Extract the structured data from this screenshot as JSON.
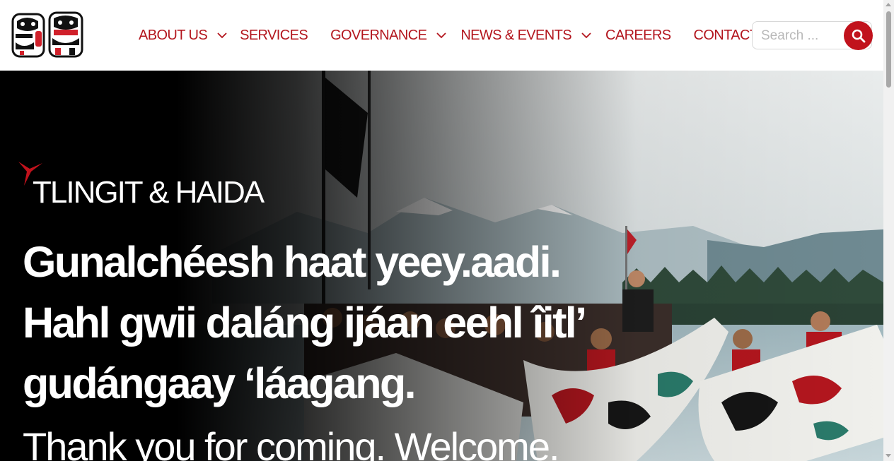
{
  "nav": {
    "items": [
      {
        "label": "ABOUT US",
        "has_dropdown": true
      },
      {
        "label": "SERVICES",
        "has_dropdown": false
      },
      {
        "label": "GOVERNANCE",
        "has_dropdown": true
      },
      {
        "label": "NEWS & EVENTS",
        "has_dropdown": true
      },
      {
        "label": "CAREERS",
        "has_dropdown": false
      },
      {
        "label": "CONTACT",
        "has_dropdown": false
      }
    ]
  },
  "search": {
    "placeholder": "Search ...",
    "icon": "search-icon"
  },
  "hero": {
    "brand": "TLINGIT & HAIDA",
    "headline": [
      "Gunalchéesh haat yeey.aadi.",
      "Hahl gwii daláng ijáan eehl îitl’",
      "gudángaay ‘láagang."
    ],
    "subheadline": "Thank you for coming. Welcome."
  },
  "colors": {
    "accent": "#b3161e",
    "search_button": "#c1121c",
    "hero_text": "#ffffff"
  }
}
